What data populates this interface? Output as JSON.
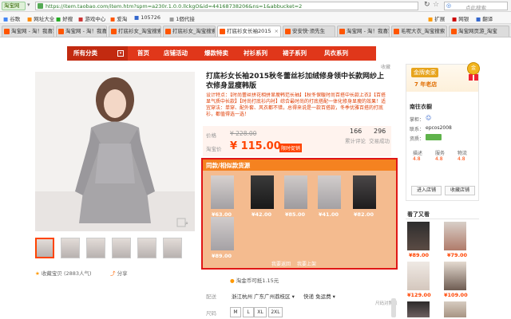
{
  "browser": {
    "mode_label": "淘宝网",
    "url": "https://item.taobao.com/item.htm?spm=a230r.1.0.0.llckgO&id=44168738206&ns=1&abbucket=2",
    "search_placeholder": "点此搜索",
    "bookmarks": [
      "谷歌",
      "网址大全",
      "好搜",
      "游戏中心",
      "爱淘",
      "105726",
      "1個代接"
    ],
    "toolbar_right": [
      "扩展",
      "网银",
      "翻译"
    ],
    "tabs": [
      "淘宝网 - 淘！我喜欢",
      "淘宝网 - 淘！我喜欢",
      "打底衫女_淘宝搜索",
      "打底衫女_淘宝搜索",
      "打底衫女长袖2015",
      "安安快·须先生",
      "淘宝网 - 淘！我喜欢",
      "毛呢大衣_淘宝搜索",
      "淘宝网页游_淘宝"
    ]
  },
  "store_nav": [
    "所有分类",
    "首页",
    "店铺活动",
    "爆款特卖",
    "衬衫系列",
    "裙子系列",
    "风衣系列"
  ],
  "collect_label": "收藏",
  "product": {
    "title": "打底衫女长袖2015秋冬蕾丝衫加绒修身领中长款网纱上衣修身显瘦韩版",
    "desc": "设计特点：【时尚蕾丝拼花相拼显瘦韩范长袖】【秋冬保暖时尚百搭中长款上衣】【百搭显气质中长款】【时尚打底衫内衬】综合最时尚的打底搭配一体化修身显瘦的效果！适宜穿法：单穿、配外套、风衣都不错，总得来说是一款百搭款，冬季优雅百搭的打底衫，都值得选一选！",
    "price_label": "价格",
    "orig_price": "¥ 228.00",
    "promo_label": "淘宝价",
    "promo_price": "¥ 115.00",
    "promo_tag": "限时促销",
    "reviews_count": "166",
    "reviews_label": "累计评论",
    "sales_count": "296",
    "sales_label": "交易成功",
    "rewards": "淘金币可抵1.15元",
    "delivery_label": "配送",
    "delivery_from": "浙江杭州",
    "delivery_to": "广东广州荔枝区",
    "delivery_fee": "快递 免运费",
    "size_label": "尺码",
    "size_guide": "尺码对照表",
    "sizes": [
      "M",
      "L",
      "XL",
      "2XL"
    ],
    "collect": "收藏宝贝",
    "collect_count": "(2883人气)",
    "share": "分享"
  },
  "similar": {
    "title": "同款/相似款货源",
    "items": [
      {
        "price": "¥63.00"
      },
      {
        "price": "¥42.00"
      },
      {
        "price": "¥85.00"
      },
      {
        "price": "¥41.00"
      },
      {
        "price": "¥82.00"
      },
      {
        "price": "¥89.00"
      }
    ],
    "prev": "我要返回",
    "next": "我要上架"
  },
  "shop": {
    "badge": "金牌卖家",
    "years": "7 年老店",
    "name": "南往衣橱",
    "rows": [
      "掌柜：",
      "联系：",
      "资质：",
      "epcos2008"
    ],
    "scores": [
      {
        "label": "描述",
        "value": "4.8"
      },
      {
        "label": "服务",
        "value": "4.8"
      },
      {
        "label": "物流",
        "value": "4.8"
      }
    ],
    "btn_enter": "进入店铺",
    "btn_collect": "收藏店铺",
    "recent_title": "看了又看",
    "recent": [
      {
        "price": "¥89.00"
      },
      {
        "price": "¥79.00"
      },
      {
        "price": "¥129.00"
      },
      {
        "price": "¥109.00"
      },
      {
        "price": "¥149.00"
      },
      {
        "price": "¥129.00"
      }
    ]
  },
  "colors": {
    "nav_red": "#e0371a",
    "taobao_orange": "#ff4400",
    "similar_panel": "#f4bb8f",
    "highlight_red": "#e01616"
  }
}
